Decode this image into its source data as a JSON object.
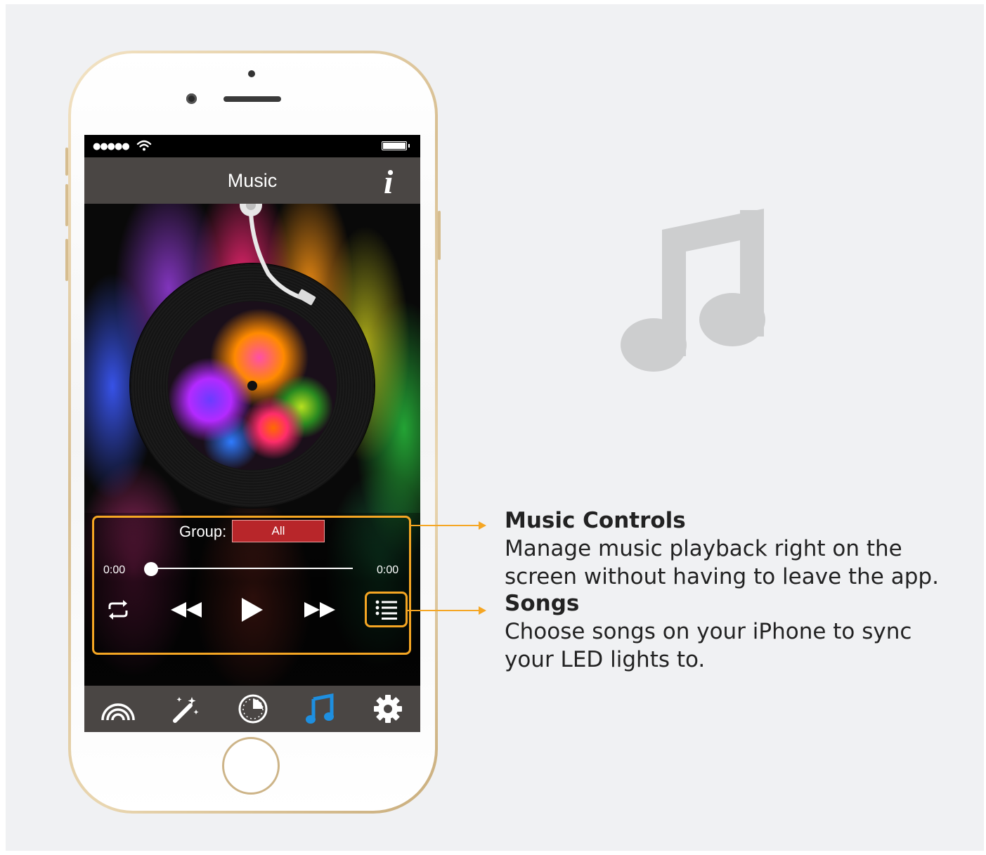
{
  "screen": {
    "nav_title": "Music",
    "info_icon": "info-icon",
    "status": {
      "signal_dots": "●●●●●"
    },
    "player": {
      "group_label": "Group:",
      "group_value": "All",
      "time_elapsed": "0:00",
      "time_total": "0:00",
      "progress": 0
    },
    "tabs": [
      "rainbow-icon",
      "magic-wand-icon",
      "timer-icon",
      "music-note-icon",
      "gear-icon"
    ],
    "active_tab": "music-note-icon",
    "active_color": "#1e8fe0"
  },
  "annotations": {
    "music_controls": {
      "title": "Music Controls",
      "body": "Manage music playback right on the screen without having to leave the app."
    },
    "songs": {
      "title": "Songs",
      "body": "Choose songs on your iPhone to sync your LED lights to."
    }
  },
  "colors": {
    "highlight": "#f5a623",
    "bar": "#4a4644",
    "background": "#f0f1f3"
  }
}
